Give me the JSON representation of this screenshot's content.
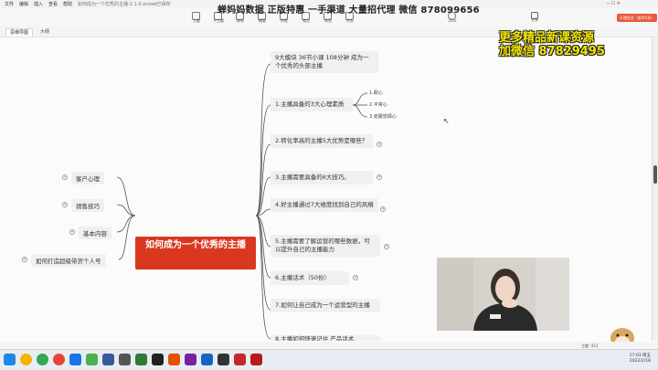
{
  "menu": [
    "文件",
    "编辑",
    "插入",
    "查看",
    "帮助"
  ],
  "doc_title": "如何成为一个优秀的主播-2.1.0.xmind",
  "doc_status": "— 已保存",
  "toolbar": [
    {
      "label": "主题"
    },
    {
      "label": "子主题"
    },
    {
      "label": "联系"
    },
    {
      "label": "概要"
    },
    {
      "label": "外框"
    },
    {
      "label": "笔记"
    },
    {
      "label": "标签"
    },
    {
      "label": "任务"
    },
    {
      "label": "25%"
    }
  ],
  "share_label": "分享",
  "pro_button": "开通会员（限时5折）",
  "tabs": [
    {
      "label": "思维导图",
      "active": true
    },
    {
      "label": "大纲",
      "active": false
    }
  ],
  "watermark_top": "蝉妈妈数据 正版特惠  一手渠道 大量招代理 微信 878099656",
  "ad_line1": "更多精品新课资源",
  "ad_line2": "加微信  87829495",
  "root": "如何成为一个优秀的主播",
  "left_nodes": [
    "客户心理",
    "销售技巧",
    "基本内容",
    "如何打造超级带货个人号"
  ],
  "right_nodes": [
    "9大模块 36节小课 108分钟 成为一个优秀的头部主播",
    "1.主播具备的3大心理素质",
    "2.转化率高的主播5大优势是哪些？",
    "3.主播需要具备的6大技巧。",
    "4.好主播通过7大维度找到自己的风格",
    "5.主播需要了解运营的哪些数据，可以提升自己的主播能力",
    "6.主播话术（50份）",
    "7.如何让自己成为一个运营型的主播",
    "8.主播如何快速记住 产品话术"
  ],
  "sub_items": [
    "1.耐心",
    "2.平常心",
    "3.克服恐惧心"
  ],
  "status_right": "主题: 413",
  "clock_time": "17:03 周五",
  "clock_date": "2022/2/18"
}
